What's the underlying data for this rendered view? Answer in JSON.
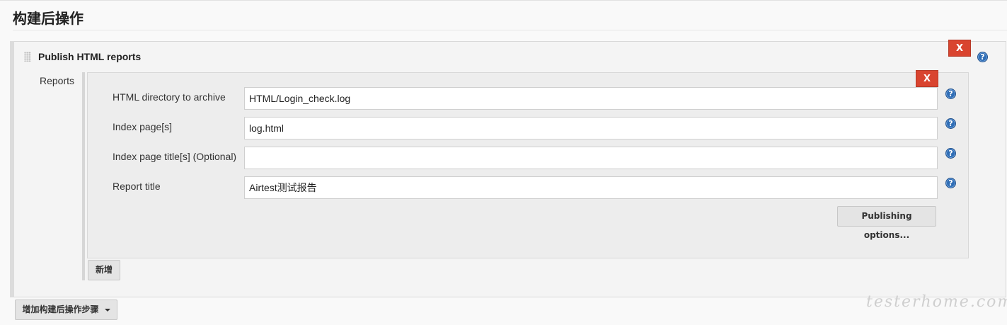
{
  "section": {
    "title": "构建后操作"
  },
  "publish_step": {
    "title": "Publish HTML reports",
    "delete_label": "X",
    "help_label": "?"
  },
  "reports": {
    "label": "Reports",
    "delete_label": "X",
    "fields": [
      {
        "label": "HTML directory to archive",
        "value": "HTML/Login_check.log"
      },
      {
        "label": "Index page[s]",
        "value": "log.html"
      },
      {
        "label": "Index page title[s] (Optional)",
        "value": ""
      },
      {
        "label": "Report title",
        "value": "Airtest测试报告"
      }
    ],
    "help_label": "?",
    "publishing_options_label": "Publishing options...",
    "add_label": "新增"
  },
  "add_step_label": "增加构建后操作步骤",
  "watermark": "testerhome.com",
  "colors": {
    "delete_red": "#d9442f",
    "help_blue": "#2f6db5"
  }
}
